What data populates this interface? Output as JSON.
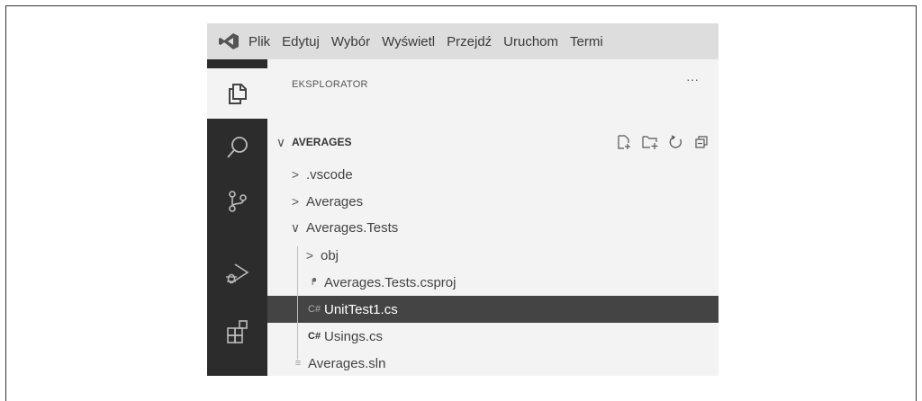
{
  "menu": [
    "Plik",
    "Edytuj",
    "Wybór",
    "Wyświetl",
    "Przejdź",
    "Uruchom",
    "Termi"
  ],
  "explorer": {
    "title": "EKSPLORATOR",
    "more": "···",
    "root": "AVERAGES",
    "items": [
      {
        "label": ".vscode",
        "chevron": ">"
      },
      {
        "label": "Averages",
        "chevron": ">"
      },
      {
        "label": "Averages.Tests",
        "chevron": "∨"
      },
      {
        "label": "obj",
        "chevron": ">"
      },
      {
        "label": "Averages.Tests.csproj",
        "icon": "rss-icon"
      },
      {
        "label": "UnitTest1.cs",
        "icon": "csharp-icon",
        "selected": true
      },
      {
        "label": "Usings.cs",
        "icon": "csharp-icon"
      },
      {
        "label": "Averages.sln",
        "icon": "lines-icon"
      }
    ]
  },
  "colors": {
    "activity_bar": "#2c2c2c",
    "selection": "#444444",
    "menubar": "#dddddd",
    "sidebar": "#f3f3f3"
  }
}
